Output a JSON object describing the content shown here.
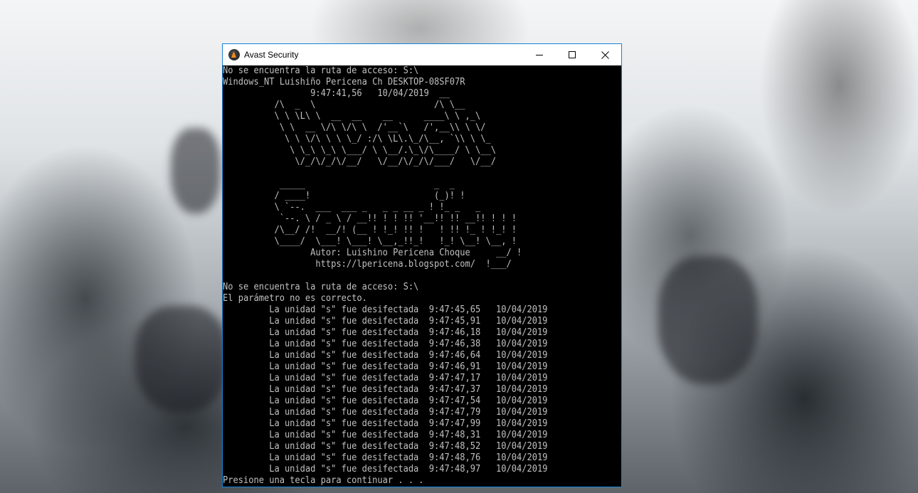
{
  "window": {
    "title": "Avast Security",
    "icon": "avast-icon",
    "controls": [
      "minimize-icon",
      "maximize-icon",
      "close-icon"
    ],
    "border_color": "#1883d7"
  },
  "console": {
    "text_color": "#c0c0c0",
    "background": "#000000",
    "header_lines": [
      "No se encuentra la ruta de acceso: S:\\",
      "Windows_NT Luishiño Pericena Ch DESKTOP-08SF07R",
      "                 9:47:41,56   10/04/2019  __"
    ],
    "banner_lines": [
      "          /\\  _  \\                       /\\ \\__",
      "          \\ \\ \\L\\ \\  __  __    __      ____\\ \\ ,_\\",
      "           \\ \\  __ \\/\\ \\/\\ \\  /'__`\\   /',__\\\\ \\ \\/",
      "            \\ \\ \\/\\ \\ \\ \\_/ :/\\ \\L\\.\\_/\\__, `\\\\ \\ \\_",
      "             \\ \\_\\ \\_\\ \\___/ \\ \\__/.\\_\\/\\____/ \\ \\__\\",
      "              \\/_/\\/_/\\/__/   \\/__/\\/_/\\/___/   \\/__/",
      "",
      "           _____                         _  _",
      "          / ____!                        (_)! !",
      "          \\ `--.  ___  ___ _   _ _ __ _ ! !_ _   _",
      "           `--. \\ / _ \\ / __!! ! ! !! '__!! !! __!! ! ! !",
      "          /\\__/ /!  __/! (__ ! !_! !! !   ! !! !_ ! !_! !",
      "          \\____/  \\___! \\___! \\__,_!!_!   !_! \\__! \\__, !",
      "                 Autor: Luishino Pericena Choque     __/ !",
      "                  https://lpericena.blogspot.com/  !___/"
    ],
    "status_lines": [
      "",
      "No se encuentra la ruta de acceso: S:\\",
      "El parámetro no es correcto."
    ],
    "disinfect_lines": [
      {
        "drive": "s",
        "time": "9:47:45,65",
        "date": "10/04/2019"
      },
      {
        "drive": "s",
        "time": "9:47:45,91",
        "date": "10/04/2019"
      },
      {
        "drive": "s",
        "time": "9:47:46,18",
        "date": "10/04/2019"
      },
      {
        "drive": "s",
        "time": "9:47:46,38",
        "date": "10/04/2019"
      },
      {
        "drive": "s",
        "time": "9:47:46,64",
        "date": "10/04/2019"
      },
      {
        "drive": "s",
        "time": "9:47:46,91",
        "date": "10/04/2019"
      },
      {
        "drive": "s",
        "time": "9:47:47,17",
        "date": "10/04/2019"
      },
      {
        "drive": "s",
        "time": "9:47:47,37",
        "date": "10/04/2019"
      },
      {
        "drive": "s",
        "time": "9:47:47,54",
        "date": "10/04/2019"
      },
      {
        "drive": "s",
        "time": "9:47:47,79",
        "date": "10/04/2019"
      },
      {
        "drive": "s",
        "time": "9:47:47,99",
        "date": "10/04/2019"
      },
      {
        "drive": "s",
        "time": "9:47:48,31",
        "date": "10/04/2019"
      },
      {
        "drive": "s",
        "time": "9:47:48,52",
        "date": "10/04/2019"
      },
      {
        "drive": "s",
        "time": "9:47:48,76",
        "date": "10/04/2019"
      },
      {
        "drive": "s",
        "time": "9:47:48,97",
        "date": "10/04/2019"
      }
    ],
    "disinfect_text": "La unidad \"{drive}\" fue desifectada",
    "footer_line": "Presione una tecla para continuar . . ."
  }
}
